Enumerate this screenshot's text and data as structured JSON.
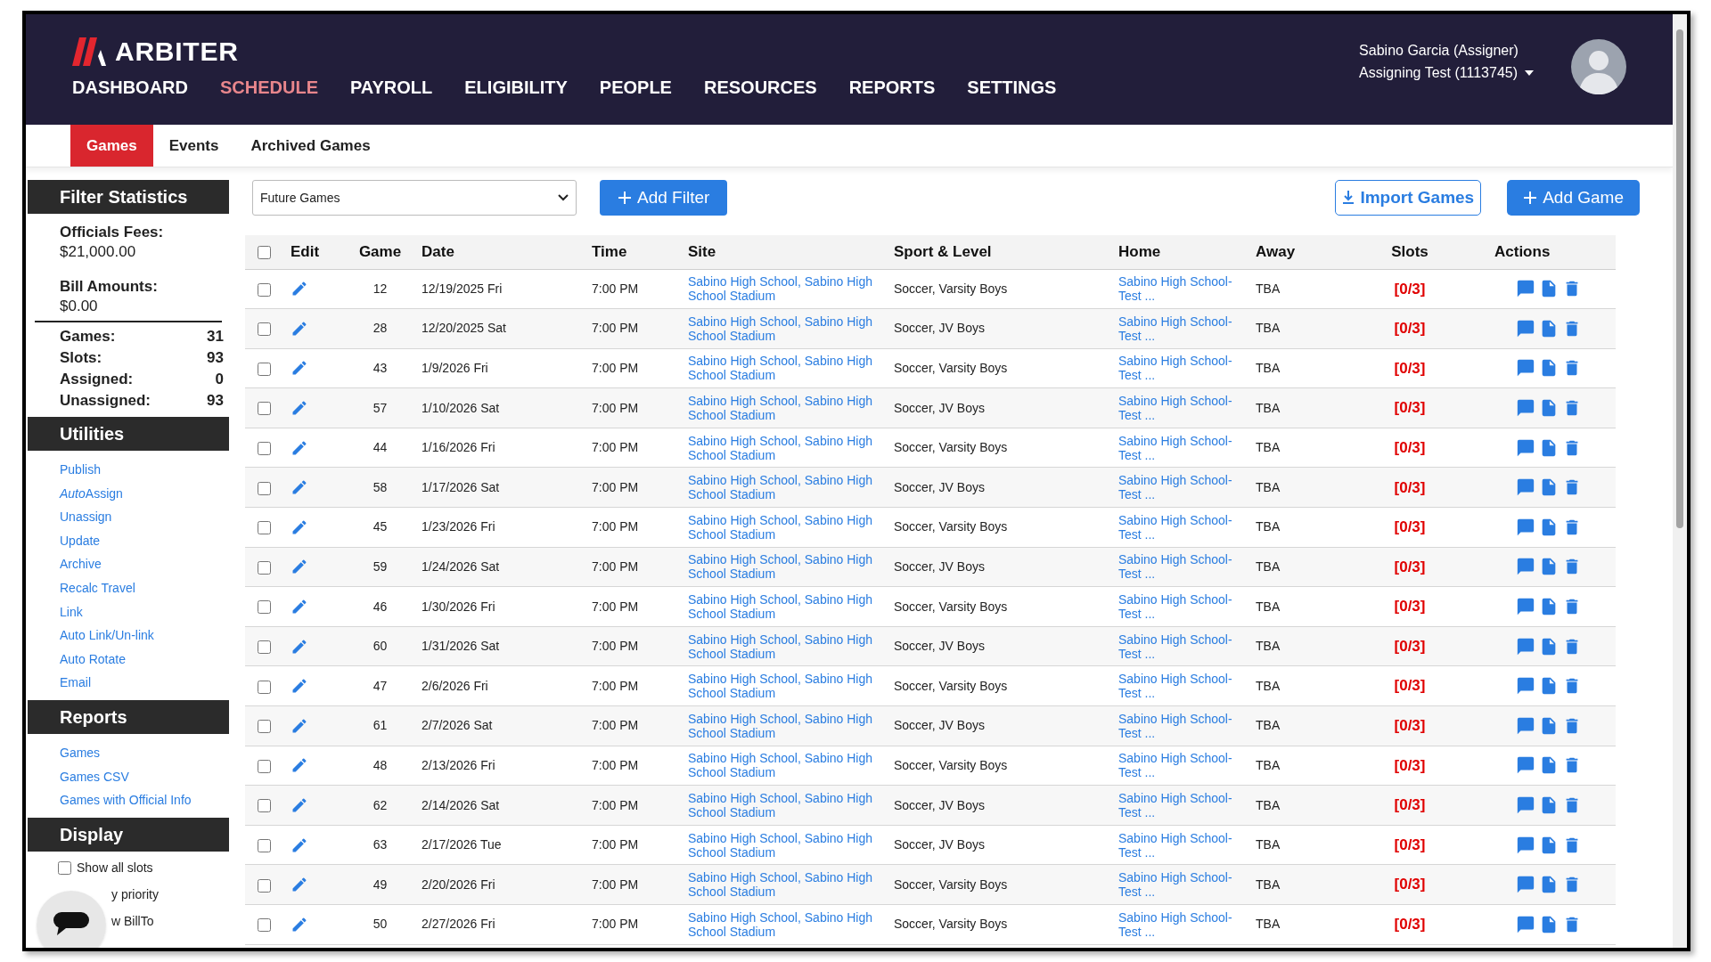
{
  "header": {
    "logo": "ARBITER",
    "nav": [
      {
        "label": "DASHBOARD",
        "selected": false
      },
      {
        "label": "SCHEDULE",
        "selected": true
      },
      {
        "label": "PAYROLL",
        "selected": false
      },
      {
        "label": "ELIGIBILITY",
        "selected": false
      },
      {
        "label": "PEOPLE",
        "selected": false
      },
      {
        "label": "RESOURCES",
        "selected": false
      },
      {
        "label": "REPORTS",
        "selected": false
      },
      {
        "label": "SETTINGS",
        "selected": false
      }
    ],
    "user": {
      "name": "Sabino Garcia (Assigner)",
      "account": "Assigning Test (1113745)"
    }
  },
  "subtabs": [
    {
      "label": "Games",
      "selected": true
    },
    {
      "label": "Events",
      "selected": false
    },
    {
      "label": "Archived Games",
      "selected": false
    }
  ],
  "sidebar": {
    "filter_statistics": {
      "title": "Filter Statistics",
      "fees_label": "Officials Fees:",
      "fees_value": "$21,000.00",
      "bill_label": "Bill Amounts:",
      "bill_value": "$0.00",
      "counts": [
        {
          "label": "Games:",
          "value": "31"
        },
        {
          "label": "Slots:",
          "value": "93"
        },
        {
          "label": "Assigned:",
          "value": "0"
        },
        {
          "label": "Unassigned:",
          "value": "93"
        }
      ]
    },
    "utilities": {
      "title": "Utilities",
      "links": [
        {
          "label": "Publish"
        },
        {
          "lead": "Auto",
          "label": "Assign"
        },
        {
          "label": "Unassign"
        },
        {
          "label": "Update"
        },
        {
          "label": "Archive"
        },
        {
          "label": "Recalc Travel"
        },
        {
          "label": "Link"
        },
        {
          "label": "Auto Link/Un-link"
        },
        {
          "label": "Auto Rotate"
        },
        {
          "label": "Email"
        }
      ]
    },
    "reports": {
      "title": "Reports",
      "links": [
        {
          "label": "Games"
        },
        {
          "label": "Games CSV"
        },
        {
          "label": "Games with Official Info"
        }
      ]
    },
    "display": {
      "title": "Display",
      "options": [
        {
          "kind": "checkbox",
          "label": "Show all slots",
          "checked": false
        },
        {
          "kind": "covered",
          "label": "y priority"
        },
        {
          "kind": "covered",
          "label": "w BillTo"
        }
      ]
    }
  },
  "toolbar": {
    "filter_select": "Future Games",
    "add_filter": "Add Filter",
    "import_games": "Import Games",
    "add_game": "Add Game"
  },
  "table": {
    "select_all": false,
    "columns": [
      "Edit",
      "Game",
      "Date",
      "Time",
      "Site",
      "Sport & Level",
      "Home",
      "Away",
      "Slots",
      "Actions"
    ],
    "rows": [
      {
        "checked": false,
        "game": "12",
        "date": "12/19/2025 Fri",
        "time": "7:00 PM",
        "site": "Sabino High School, Sabino High School Stadium",
        "sport_level": "Soccer, Varsity Boys",
        "home": "Sabino High School-Test ...",
        "away": "TBA",
        "slots": "[0/3]"
      },
      {
        "checked": false,
        "game": "28",
        "date": "12/20/2025 Sat",
        "time": "7:00 PM",
        "site": "Sabino High School, Sabino High School Stadium",
        "sport_level": "Soccer, JV Boys",
        "home": "Sabino High School-Test ...",
        "away": "TBA",
        "slots": "[0/3]"
      },
      {
        "checked": false,
        "game": "43",
        "date": "1/9/2026 Fri",
        "time": "7:00 PM",
        "site": "Sabino High School, Sabino High School Stadium",
        "sport_level": "Soccer, Varsity Boys",
        "home": "Sabino High School-Test ...",
        "away": "TBA",
        "slots": "[0/3]"
      },
      {
        "checked": false,
        "game": "57",
        "date": "1/10/2026 Sat",
        "time": "7:00 PM",
        "site": "Sabino High School, Sabino High School Stadium",
        "sport_level": "Soccer, JV Boys",
        "home": "Sabino High School-Test ...",
        "away": "TBA",
        "slots": "[0/3]"
      },
      {
        "checked": false,
        "game": "44",
        "date": "1/16/2026 Fri",
        "time": "7:00 PM",
        "site": "Sabino High School, Sabino High School Stadium",
        "sport_level": "Soccer, Varsity Boys",
        "home": "Sabino High School-Test ...",
        "away": "TBA",
        "slots": "[0/3]"
      },
      {
        "checked": false,
        "game": "58",
        "date": "1/17/2026 Sat",
        "time": "7:00 PM",
        "site": "Sabino High School, Sabino High School Stadium",
        "sport_level": "Soccer, JV Boys",
        "home": "Sabino High School-Test ...",
        "away": "TBA",
        "slots": "[0/3]"
      },
      {
        "checked": false,
        "game": "45",
        "date": "1/23/2026 Fri",
        "time": "7:00 PM",
        "site": "Sabino High School, Sabino High School Stadium",
        "sport_level": "Soccer, Varsity Boys",
        "home": "Sabino High School-Test ...",
        "away": "TBA",
        "slots": "[0/3]"
      },
      {
        "checked": false,
        "game": "59",
        "date": "1/24/2026 Sat",
        "time": "7:00 PM",
        "site": "Sabino High School, Sabino High School Stadium",
        "sport_level": "Soccer, JV Boys",
        "home": "Sabino High School-Test ...",
        "away": "TBA",
        "slots": "[0/3]"
      },
      {
        "checked": false,
        "game": "46",
        "date": "1/30/2026 Fri",
        "time": "7:00 PM",
        "site": "Sabino High School, Sabino High School Stadium",
        "sport_level": "Soccer, Varsity Boys",
        "home": "Sabino High School-Test ...",
        "away": "TBA",
        "slots": "[0/3]"
      },
      {
        "checked": false,
        "game": "60",
        "date": "1/31/2026 Sat",
        "time": "7:00 PM",
        "site": "Sabino High School, Sabino High School Stadium",
        "sport_level": "Soccer, JV Boys",
        "home": "Sabino High School-Test ...",
        "away": "TBA",
        "slots": "[0/3]"
      },
      {
        "checked": false,
        "game": "47",
        "date": "2/6/2026 Fri",
        "time": "7:00 PM",
        "site": "Sabino High School, Sabino High School Stadium",
        "sport_level": "Soccer, Varsity Boys",
        "home": "Sabino High School-Test ...",
        "away": "TBA",
        "slots": "[0/3]"
      },
      {
        "checked": false,
        "game": "61",
        "date": "2/7/2026 Sat",
        "time": "7:00 PM",
        "site": "Sabino High School, Sabino High School Stadium",
        "sport_level": "Soccer, JV Boys",
        "home": "Sabino High School-Test ...",
        "away": "TBA",
        "slots": "[0/3]"
      },
      {
        "checked": false,
        "game": "48",
        "date": "2/13/2026 Fri",
        "time": "7:00 PM",
        "site": "Sabino High School, Sabino High School Stadium",
        "sport_level": "Soccer, Varsity Boys",
        "home": "Sabino High School-Test ...",
        "away": "TBA",
        "slots": "[0/3]"
      },
      {
        "checked": false,
        "game": "62",
        "date": "2/14/2026 Sat",
        "time": "7:00 PM",
        "site": "Sabino High School, Sabino High School Stadium",
        "sport_level": "Soccer, JV Boys",
        "home": "Sabino High School-Test ...",
        "away": "TBA",
        "slots": "[0/3]"
      },
      {
        "checked": false,
        "game": "63",
        "date": "2/17/2026 Tue",
        "time": "7:00 PM",
        "site": "Sabino High School, Sabino High School Stadium",
        "sport_level": "Soccer, JV Boys",
        "home": "Sabino High School-Test ...",
        "away": "TBA",
        "slots": "[0/3]"
      },
      {
        "checked": false,
        "game": "49",
        "date": "2/20/2026 Fri",
        "time": "7:00 PM",
        "site": "Sabino High School, Sabino High School Stadium",
        "sport_level": "Soccer, Varsity Boys",
        "home": "Sabino High School-Test ...",
        "away": "TBA",
        "slots": "[0/3]"
      },
      {
        "checked": false,
        "game": "50",
        "date": "2/27/2026 Fri",
        "time": "7:00 PM",
        "site": "Sabino High School, Sabino High School Stadium",
        "sport_level": "Soccer, Varsity Boys",
        "home": "Sabino High School-Test ...",
        "away": "TBA",
        "slots": "[0/3]"
      }
    ]
  }
}
